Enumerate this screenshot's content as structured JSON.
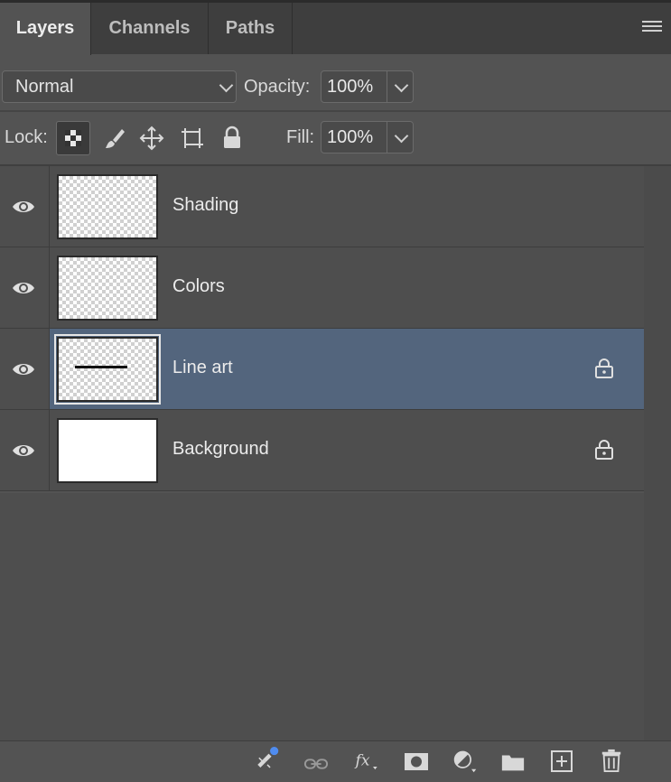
{
  "tabs": [
    {
      "label": "Layers",
      "active": true
    },
    {
      "label": "Channels",
      "active": false
    },
    {
      "label": "Paths",
      "active": false
    }
  ],
  "panel_menu_icon": "hamburger-menu-icon",
  "blend_mode": {
    "selected": "Normal"
  },
  "opacity": {
    "label": "Opacity:",
    "value": "100%"
  },
  "lock": {
    "label": "Lock:",
    "buttons": [
      "lock-transparent-pixels-icon",
      "lock-image-pixels-icon",
      "lock-position-icon",
      "lock-artboard-icon",
      "lock-all-icon"
    ]
  },
  "fill": {
    "label": "Fill:",
    "value": "100%"
  },
  "layers": [
    {
      "name": "Shading",
      "visible": true,
      "locked": false,
      "selected": false,
      "thumb": "transparent"
    },
    {
      "name": "Colors",
      "visible": true,
      "locked": false,
      "selected": false,
      "thumb": "transparent"
    },
    {
      "name": "Line art",
      "visible": true,
      "locked": true,
      "selected": true,
      "thumb": "line"
    },
    {
      "name": "Background",
      "visible": true,
      "locked": true,
      "selected": false,
      "thumb": "white"
    }
  ],
  "bottom_toolbar": [
    "contextual-task-bar-icon",
    "link-layers-icon",
    "layer-style-fx-icon",
    "layer-mask-icon",
    "adjustment-layer-icon",
    "new-group-folder-icon",
    "new-layer-icon",
    "delete-layer-icon"
  ],
  "colors": {
    "panel": "#535353",
    "tabbar": "#3e3e3e",
    "selected_layer": "#53657d",
    "notification_dot": "#4f8cf0"
  }
}
